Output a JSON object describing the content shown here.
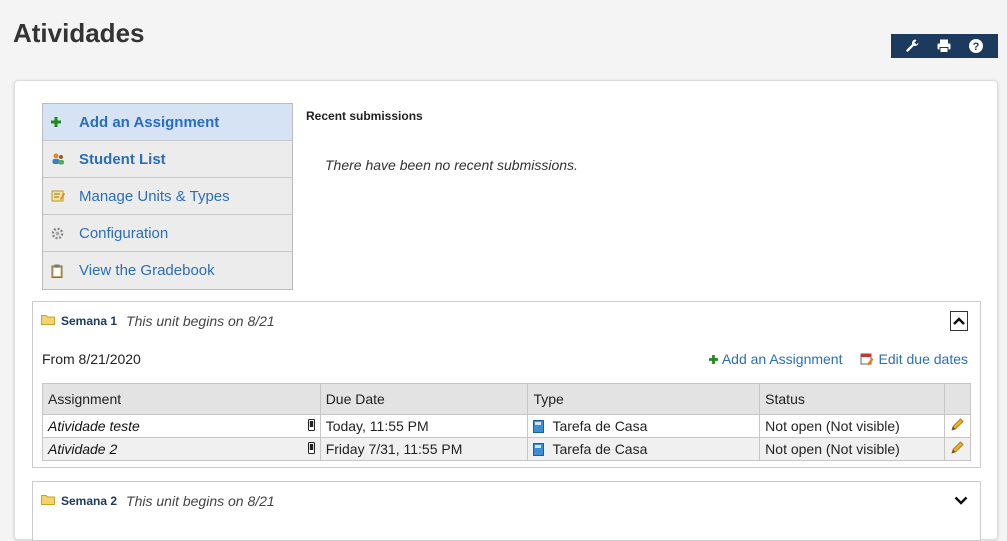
{
  "page": {
    "title": "Atividades"
  },
  "toolbar": {
    "buttons": [
      {
        "name": "wrench-icon"
      },
      {
        "name": "print-icon"
      },
      {
        "name": "help-icon"
      }
    ],
    "bg_color": "#1b3a5e"
  },
  "sidemenu": {
    "items": [
      {
        "label": "Add an Assignment",
        "icon": "add-icon",
        "active": true
      },
      {
        "label": "Student List",
        "icon": "users-icon",
        "active": false
      },
      {
        "label": "Manage Units & Types",
        "icon": "edit-list-icon",
        "active": false
      },
      {
        "label": "Configuration",
        "icon": "gear-icon",
        "active": false
      },
      {
        "label": "View the Gradebook",
        "icon": "clipboard-icon",
        "active": false
      }
    ]
  },
  "recent": {
    "title": "Recent submissions",
    "empty_text": "There have been no recent submissions."
  },
  "units": [
    {
      "name": "Semana 1",
      "begins": "This unit begins on 8/21",
      "from": "From 8/21/2020",
      "actions": {
        "add": "Add an Assignment",
        "edit_due": "Edit due dates"
      },
      "columns": [
        "Assignment",
        "Due Date",
        "Type",
        "Status",
        ""
      ],
      "rows": [
        {
          "name": "Atividade teste",
          "due": "Today, 11:55 PM",
          "type": "Tarefa de Casa",
          "status": "Not open (Not visible)"
        },
        {
          "name": "Atividade 2",
          "due": "Friday 7/31, 11:55 PM",
          "type": "Tarefa de Casa",
          "status": "Not open (Not visible)"
        }
      ]
    },
    {
      "name": "Semana 2",
      "begins": "This unit begins on 8/21"
    }
  ]
}
